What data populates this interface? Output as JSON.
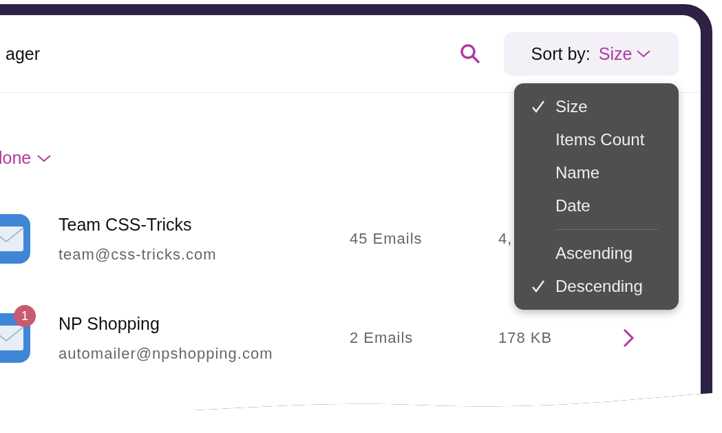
{
  "title": "ager",
  "sort": {
    "label": "Sort by:",
    "value": "Size"
  },
  "filter": {
    "label": "lone"
  },
  "accounts": [
    {
      "name": "Team CSS-Tricks",
      "email": "team@css-tricks.com",
      "count": "45 Emails",
      "size": "4,",
      "chevron": false
    },
    {
      "name": "NP Shopping",
      "email": "automailer@npshopping.com",
      "count": "2 Emails",
      "size": "178 KB",
      "badge": "1",
      "chevron": true
    }
  ],
  "menu": [
    {
      "kind": "option",
      "label": "Size",
      "selected": true
    },
    {
      "kind": "option",
      "label": "Items Count",
      "selected": false
    },
    {
      "kind": "option",
      "label": "Name",
      "selected": false
    },
    {
      "kind": "option",
      "label": "Date",
      "selected": false
    },
    {
      "kind": "divider"
    },
    {
      "kind": "option",
      "label": "Ascending",
      "selected": false
    },
    {
      "kind": "option",
      "label": "Descending",
      "selected": true
    }
  ]
}
